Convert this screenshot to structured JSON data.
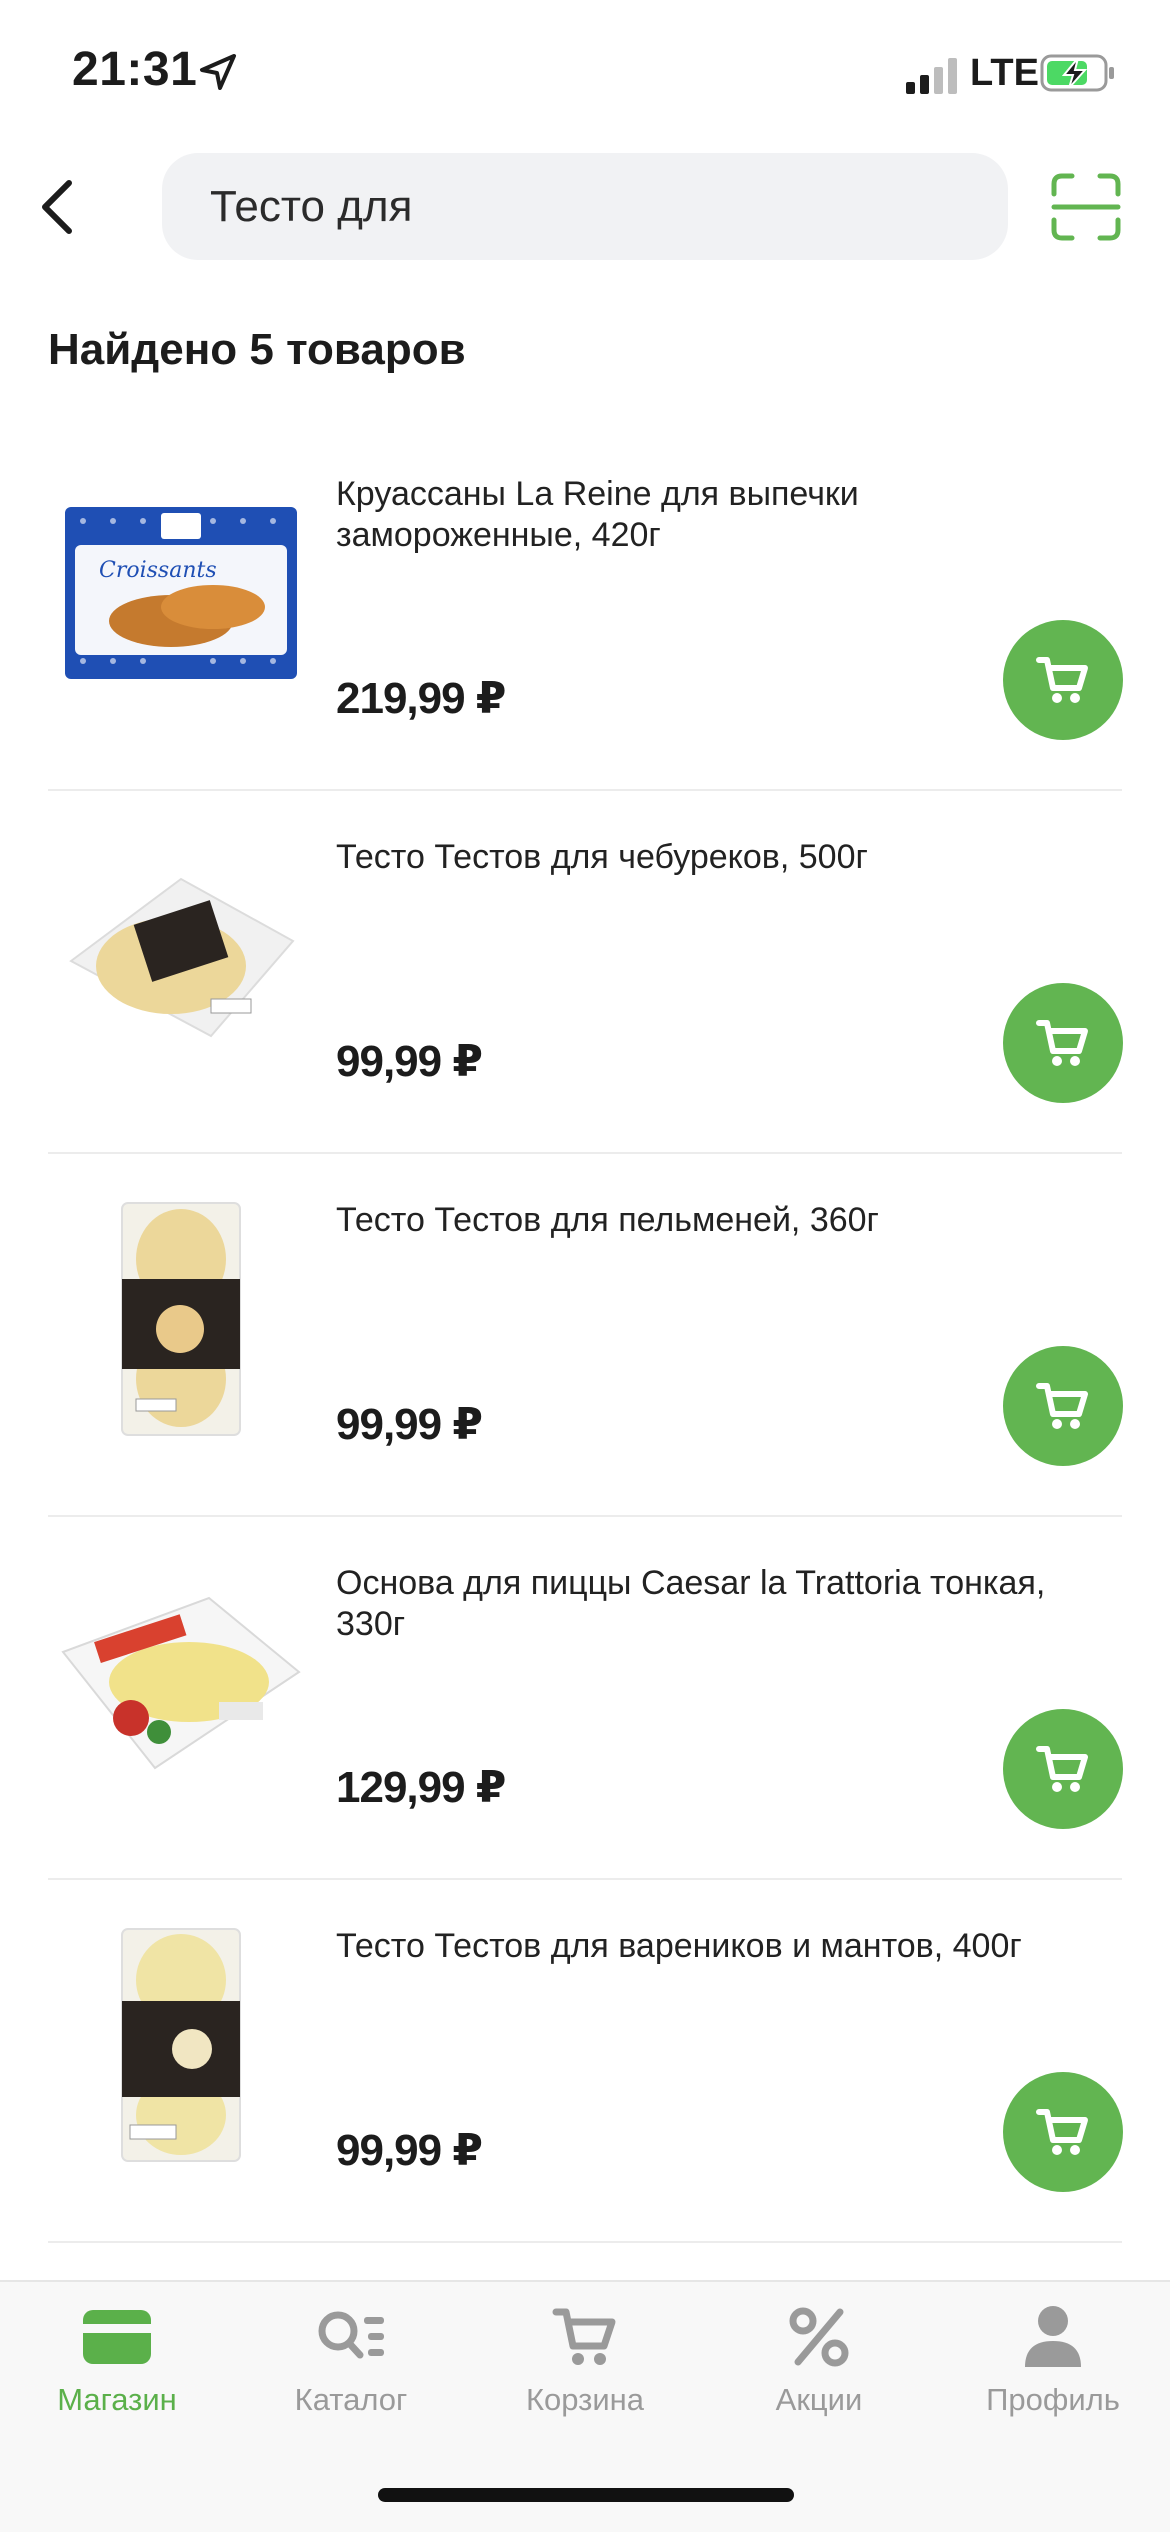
{
  "status_bar": {
    "time": "21:31",
    "network": "LTE",
    "icons": [
      "location-arrow-icon",
      "signal-icon",
      "battery-charging-icon"
    ]
  },
  "header": {
    "back_icon": "chevron-left-icon",
    "search_value": "Тесто для",
    "scan_icon": "barcode-scan-icon"
  },
  "results": {
    "title": "Найдено 5 товаров"
  },
  "colors": {
    "accent": "#62b551",
    "tab_active": "#5bb04a",
    "tab_inactive": "#9a9a9a",
    "search_bg": "#f1f2f4"
  },
  "products": [
    {
      "name": "Круассаны La Reine для выпечки замороженные, 420г",
      "price": "219,99 ₽",
      "image": "croissants-package"
    },
    {
      "name": "Тесто Тестов для чебуреков, 500г",
      "price": "99,99 ₽",
      "image": "dough-package-round"
    },
    {
      "name": "Тесто Тестов для пельменей, 360г",
      "price": "99,99 ₽",
      "image": "dough-package-tall"
    },
    {
      "name": "Основа для пиццы Caesar la Trattoria тонкая, 330г",
      "price": "129,99 ₽",
      "image": "pizza-base-box"
    },
    {
      "name": "Тесто Тестов для вареников и мантов, 400г",
      "price": "99,99 ₽",
      "image": "dough-package-tall"
    }
  ],
  "tab_bar": {
    "active": "Магазин",
    "tabs": [
      {
        "label": "Магазин",
        "icon": "card-icon"
      },
      {
        "label": "Каталог",
        "icon": "catalog-search-icon"
      },
      {
        "label": "Корзина",
        "icon": "cart-icon"
      },
      {
        "label": "Акции",
        "icon": "percent-icon"
      },
      {
        "label": "Профиль",
        "icon": "profile-icon"
      }
    ]
  }
}
